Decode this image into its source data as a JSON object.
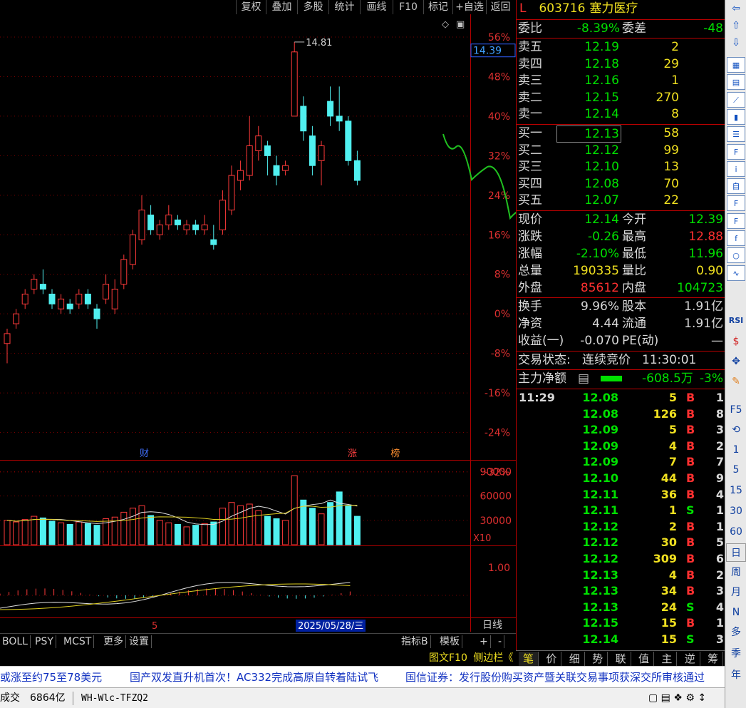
{
  "toolbar": {
    "buttons": [
      "复权",
      "叠加",
      "多股",
      "统计",
      "画线",
      "F10",
      "标记",
      "+自选",
      "返回"
    ]
  },
  "stock": {
    "market": "L",
    "code": "603716",
    "name": "塞力医疗"
  },
  "order_book": {
    "webi_label": "委比",
    "webi_value": "-8.39%",
    "weicha_label": "委差",
    "weicha_value": "-48",
    "asks": [
      {
        "label": "卖五",
        "price": "12.19",
        "vol": "2"
      },
      {
        "label": "卖四",
        "price": "12.18",
        "vol": "29"
      },
      {
        "label": "卖三",
        "price": "12.16",
        "vol": "1"
      },
      {
        "label": "卖二",
        "price": "12.15",
        "vol": "270"
      },
      {
        "label": "卖一",
        "price": "12.14",
        "vol": "8"
      }
    ],
    "bids": [
      {
        "label": "买一",
        "price": "12.13",
        "vol": "58"
      },
      {
        "label": "买二",
        "price": "12.12",
        "vol": "99"
      },
      {
        "label": "买三",
        "price": "12.10",
        "vol": "13"
      },
      {
        "label": "买四",
        "price": "12.08",
        "vol": "70"
      },
      {
        "label": "买五",
        "price": "12.07",
        "vol": "22"
      }
    ]
  },
  "quote": [
    {
      "l1": "现价",
      "v1": "12.14",
      "c1": "grn",
      "l2": "今开",
      "v2": "12.39",
      "c2": "grn"
    },
    {
      "l1": "涨跌",
      "v1": "-0.26",
      "c1": "grn",
      "l2": "最高",
      "v2": "12.88",
      "c2": "red"
    },
    {
      "l1": "涨幅",
      "v1": "-2.10%",
      "c1": "grn",
      "l2": "最低",
      "v2": "11.96",
      "c2": "grn"
    },
    {
      "l1": "总量",
      "v1": "190335",
      "c1": "yel",
      "l2": "量比",
      "v2": "0.90",
      "c2": "yel"
    },
    {
      "l1": "外盘",
      "v1": "85612",
      "c1": "red",
      "l2": "内盘",
      "v2": "104723",
      "c2": "grn"
    }
  ],
  "stats": [
    {
      "l1": "换手",
      "v1": "9.96%",
      "l2": "股本",
      "v2": "1.91亿"
    },
    {
      "l1": "净资",
      "v1": "4.44",
      "l2": "流通",
      "v2": "1.91亿"
    },
    {
      "l1": "收益(一)",
      "v1": "-0.070",
      "l2": "PE(动)",
      "v2": "—"
    }
  ],
  "trade_status": {
    "label": "交易状态:",
    "value": "连续竞价",
    "time": "11:30:01"
  },
  "main_flow": {
    "label": "主力净额",
    "value": "-608.5万",
    "pct": "-3%"
  },
  "ticks": [
    {
      "time": "11:29",
      "price": "12.08",
      "vol": "5",
      "side": "B",
      "n": "1"
    },
    {
      "time": "",
      "price": "12.08",
      "vol": "126",
      "side": "B",
      "n": "8"
    },
    {
      "time": "",
      "price": "12.09",
      "vol": "5",
      "side": "B",
      "n": "3"
    },
    {
      "time": "",
      "price": "12.09",
      "vol": "4",
      "side": "B",
      "n": "2"
    },
    {
      "time": "",
      "price": "12.09",
      "vol": "7",
      "side": "B",
      "n": "7"
    },
    {
      "time": "",
      "price": "12.10",
      "vol": "44",
      "side": "B",
      "n": "9"
    },
    {
      "time": "",
      "price": "12.11",
      "vol": "36",
      "side": "B",
      "n": "4"
    },
    {
      "time": "",
      "price": "12.11",
      "vol": "1",
      "side": "S",
      "n": "1"
    },
    {
      "time": "",
      "price": "12.12",
      "vol": "2",
      "side": "B",
      "n": "1"
    },
    {
      "time": "",
      "price": "12.12",
      "vol": "30",
      "side": "B",
      "n": "5"
    },
    {
      "time": "",
      "price": "12.12",
      "vol": "309",
      "side": "B",
      "n": "6"
    },
    {
      "time": "",
      "price": "12.13",
      "vol": "4",
      "side": "B",
      "n": "2"
    },
    {
      "time": "",
      "price": "12.13",
      "vol": "34",
      "side": "B",
      "n": "3"
    },
    {
      "time": "",
      "price": "12.13",
      "vol": "24",
      "side": "S",
      "n": "4"
    },
    {
      "time": "",
      "price": "12.15",
      "vol": "15",
      "side": "B",
      "n": "1"
    },
    {
      "time": "",
      "price": "12.14",
      "vol": "15",
      "side": "S",
      "n": "3"
    }
  ],
  "right_tabs": [
    "笔",
    "价",
    "细",
    "势",
    "联",
    "值",
    "主",
    "逆",
    "筹"
  ],
  "f10_label": "图文F10",
  "side_label": "侧边栏《",
  "bottom_tabs": [
    "BOLL",
    "PSY",
    "MCST",
    "更多",
    "设置"
  ],
  "bottom_right": {
    "indicator": "指标B",
    "template": "模板",
    "plus": "+",
    "minus": "-",
    "period": "日线"
  },
  "date_label": "2025/05/28/三",
  "date_tick": "5",
  "ticker": {
    "items": [
      "或涨至约75至78美元",
      "国产双发直升机首次！AC332完成高原自转着陆试飞",
      "国信证券：发行股份购买资产暨关联交易事项获深交所审核通过"
    ]
  },
  "status": {
    "label": "成交",
    "amount": "6864亿",
    "code": "WH-Wlc-TFZQ2"
  },
  "side_tools": {
    "top_icons": [
      "arrow-left-icon",
      "arrow-up-icon",
      "arrow-down-icon",
      "report-icon",
      "grid-icon",
      "line-chart-icon",
      "candle-icon",
      "list-icon",
      "f10-icon",
      "info-icon",
      "self-icon",
      "f11-icon",
      "f12-icon",
      "fx-icon",
      "circle-icon",
      "wave-icon"
    ],
    "labels": [
      "RSI",
      "$",
      "✥",
      "✎",
      "F5",
      "⟲",
      "1",
      "5",
      "15",
      "30",
      "60",
      "日",
      "周",
      "月",
      "N",
      "多",
      "季",
      "年"
    ]
  },
  "chart_data": {
    "type": "candlestick",
    "price_axis_labels": [
      "56%",
      "48%",
      "40%",
      "32%",
      "24%",
      "16%",
      "8%",
      "0%",
      "-8%",
      "-16%",
      "-24%",
      "-32%"
    ],
    "price_axis_values": [
      56,
      48,
      40,
      32,
      24,
      16,
      8,
      0,
      -8,
      -16,
      -24,
      -32
    ],
    "current_price_label": "14.39",
    "high_marker": "14.81",
    "event_markers": [
      {
        "label": "财",
        "x_index": 10
      },
      {
        "label": "涨",
        "x_index": 30
      },
      {
        "label": "榜",
        "x_index": 34
      }
    ],
    "volume_axis_labels": [
      "90000",
      "60000",
      "30000"
    ],
    "volume_axis_values": [
      90000,
      60000,
      30000
    ],
    "volume_unit": "X10",
    "macd_axis_label": "1.00",
    "candles": [
      {
        "o": -6,
        "c": -4,
        "h": -3,
        "l": -10
      },
      {
        "o": -2,
        "c": 0,
        "h": 1,
        "l": -3
      },
      {
        "o": 2,
        "c": 4,
        "h": 5,
        "l": 1
      },
      {
        "o": 5,
        "c": 7,
        "h": 8,
        "l": 4
      },
      {
        "o": 6,
        "c": 5,
        "h": 9,
        "l": 4
      },
      {
        "o": 4,
        "c": 2,
        "h": 5,
        "l": 1
      },
      {
        "o": 1,
        "c": 3,
        "h": 4,
        "l": 0
      },
      {
        "o": 2,
        "c": 1,
        "h": 3,
        "l": 0
      },
      {
        "o": 2,
        "c": 4,
        "h": 5,
        "l": 1
      },
      {
        "o": 4,
        "c": 2,
        "h": 5,
        "l": 1
      },
      {
        "o": 1,
        "c": -1,
        "h": 2,
        "l": -3
      },
      {
        "o": 3,
        "c": 6,
        "h": 8,
        "l": 2
      },
      {
        "o": 1,
        "c": 5,
        "h": 7,
        "l": 0
      },
      {
        "o": 6,
        "c": 11,
        "h": 12,
        "l": 5
      },
      {
        "o": 10,
        "c": 16,
        "h": 17,
        "l": 9
      },
      {
        "o": 15,
        "c": 21,
        "h": 24,
        "l": 14
      },
      {
        "o": 20,
        "c": 17,
        "h": 22,
        "l": 16
      },
      {
        "o": 16,
        "c": 18,
        "h": 19,
        "l": 15
      },
      {
        "o": 18,
        "c": 20,
        "h": 22,
        "l": 17
      },
      {
        "o": 19,
        "c": 18,
        "h": 20,
        "l": 17
      },
      {
        "o": 17,
        "c": 18,
        "h": 19,
        "l": 16
      },
      {
        "o": 18,
        "c": 17,
        "h": 19,
        "l": 16
      },
      {
        "o": 17,
        "c": 18,
        "h": 20,
        "l": 16
      },
      {
        "o": 15,
        "c": 14,
        "h": 18,
        "l": 13
      },
      {
        "o": 17,
        "c": 23,
        "h": 25,
        "l": 16
      },
      {
        "o": 21,
        "c": 28,
        "h": 30,
        "l": 20
      },
      {
        "o": 27,
        "c": 29,
        "h": 31,
        "l": 25
      },
      {
        "o": 28,
        "c": 34,
        "h": 40,
        "l": 27
      },
      {
        "o": 33,
        "c": 36,
        "h": 38,
        "l": 31
      },
      {
        "o": 34,
        "c": 32,
        "h": 35,
        "l": 28
      },
      {
        "o": 30,
        "c": 28,
        "h": 32,
        "l": 26
      },
      {
        "o": 29,
        "c": 30,
        "h": 31,
        "l": 28
      },
      {
        "o": 40,
        "c": 53,
        "h": 55,
        "l": 40
      },
      {
        "o": 42,
        "c": 37,
        "h": 44,
        "l": 35
      },
      {
        "o": 36,
        "c": 30,
        "h": 38,
        "l": 28
      },
      {
        "o": 31,
        "c": 34,
        "h": 35,
        "l": 26
      },
      {
        "o": 43,
        "c": 40,
        "h": 46,
        "l": 38
      },
      {
        "o": 40,
        "c": 39,
        "h": 46,
        "l": 37
      },
      {
        "o": 39,
        "c": 31,
        "h": 40,
        "l": 30
      },
      {
        "o": 31,
        "c": 27,
        "h": 33,
        "l": 26
      }
    ],
    "volumes": [
      30000,
      28000,
      31000,
      35000,
      33000,
      29000,
      27000,
      25000,
      28000,
      26000,
      24000,
      32000,
      34000,
      40000,
      45000,
      48000,
      36000,
      30000,
      27000,
      25000,
      22000,
      24000,
      26000,
      28000,
      45000,
      52000,
      48000,
      50000,
      42000,
      35000,
      32000,
      30000,
      85000,
      55000,
      45000,
      38000,
      52000,
      65000,
      48000,
      35000
    ],
    "vol_up": [
      1,
      1,
      1,
      1,
      0,
      0,
      1,
      0,
      1,
      0,
      0,
      1,
      1,
      1,
      1,
      1,
      0,
      1,
      1,
      0,
      1,
      0,
      1,
      0,
      1,
      1,
      1,
      1,
      1,
      0,
      0,
      1,
      1,
      0,
      0,
      1,
      0,
      0,
      0,
      0
    ]
  }
}
